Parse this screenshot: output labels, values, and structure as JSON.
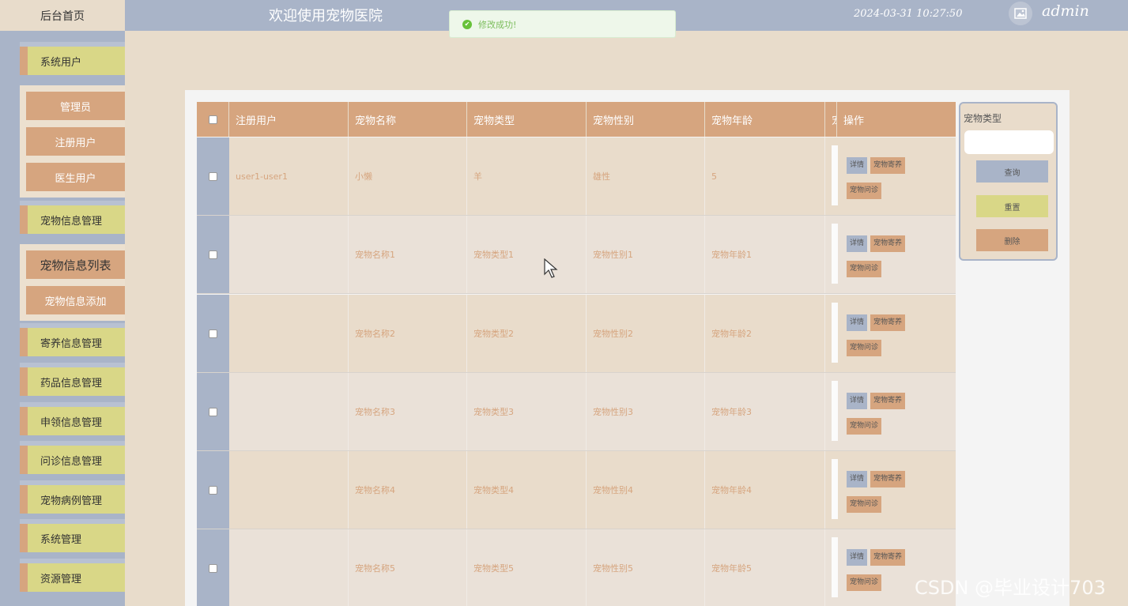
{
  "header": {
    "home_label": "后台首页",
    "title": "欢迎使用宠物医院",
    "datetime": "2024-03-31 10:27:50",
    "username": "admin",
    "avatar_icon": "image-icon"
  },
  "toast": {
    "message": "修改成功!",
    "icon": "success-icon"
  },
  "sidebar": {
    "items": [
      {
        "label": "系统用户"
      },
      {
        "label": "管理员"
      },
      {
        "label": "注册用户"
      },
      {
        "label": "医生用户"
      },
      {
        "label": "宠物信息管理"
      },
      {
        "label": "宠物信息列表"
      },
      {
        "label": "宠物信息添加"
      },
      {
        "label": "寄养信息管理"
      },
      {
        "label": "药品信息管理"
      },
      {
        "label": "申领信息管理"
      },
      {
        "label": "问诊信息管理"
      },
      {
        "label": "宠物病例管理"
      },
      {
        "label": "系统管理"
      },
      {
        "label": "资源管理"
      }
    ]
  },
  "table": {
    "headers": [
      "注册用户",
      "宠物名称",
      "宠物类型",
      "宠物性别",
      "宠物年龄",
      "宠",
      "操作"
    ],
    "rows": [
      {
        "user": "user1-user1",
        "name": "小懒",
        "type": "羊",
        "gender": "雄性",
        "age": "5"
      },
      {
        "user": "",
        "name": "宠物名称1",
        "type": "宠物类型1",
        "gender": "宠物性别1",
        "age": "宠物年龄1"
      },
      {
        "user": "",
        "name": "宠物名称2",
        "type": "宠物类型2",
        "gender": "宠物性别2",
        "age": "宠物年龄2"
      },
      {
        "user": "",
        "name": "宠物名称3",
        "type": "宠物类型3",
        "gender": "宠物性别3",
        "age": "宠物年龄3"
      },
      {
        "user": "",
        "name": "宠物名称4",
        "type": "宠物类型4",
        "gender": "宠物性别4",
        "age": "宠物年龄4"
      },
      {
        "user": "",
        "name": "宠物名称5",
        "type": "宠物类型5",
        "gender": "宠物性别5",
        "age": "宠物年龄5"
      }
    ],
    "actions": {
      "detail": "详情",
      "foster": "宠物寄养",
      "consult": "宠物问诊"
    }
  },
  "search": {
    "label": "宠物类型",
    "input_value": "",
    "query_label": "查询",
    "reset_label": "重置",
    "delete_label": "删除"
  },
  "watermark": "CSDN @毕业设计703",
  "colors": {
    "sidebar_bg": "#a9b4c8",
    "page_bg": "#e8dccb",
    "accent_orange": "#d6a57f",
    "accent_yellow": "#d9d787"
  }
}
